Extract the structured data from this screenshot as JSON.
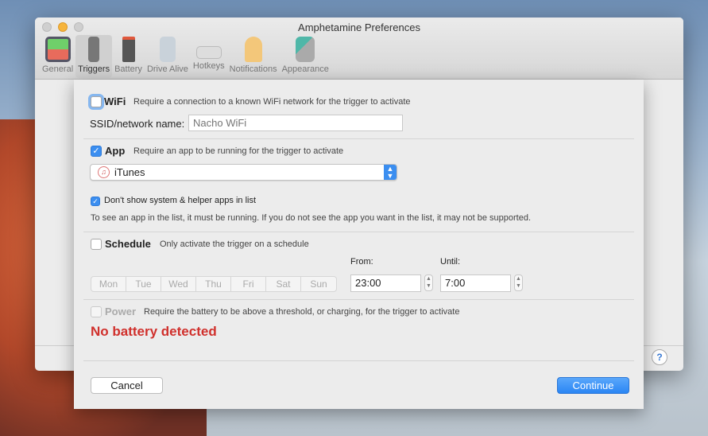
{
  "window": {
    "title": "Amphetamine Preferences"
  },
  "toolbar": [
    {
      "label": "General",
      "icon": "toggles-icon"
    },
    {
      "label": "Triggers",
      "icon": "traffic-light-icon"
    },
    {
      "label": "Battery",
      "icon": "battery-icon"
    },
    {
      "label": "Drive Alive",
      "icon": "drive-icon"
    },
    {
      "label": "Hotkeys",
      "icon": "keyboard-icon"
    },
    {
      "label": "Notifications",
      "icon": "bell-icon"
    },
    {
      "label": "Appearance",
      "icon": "paint-icon"
    }
  ],
  "help": "?",
  "wifi": {
    "label": "WiFi",
    "desc": "Require a connection to a known WiFi network for the trigger to activate",
    "checked": false,
    "ssid_label": "SSID/network name:",
    "ssid_placeholder": "Nacho WiFi"
  },
  "app": {
    "label": "App",
    "desc": "Require an app to be running for the trigger to activate",
    "checked": true,
    "selected": "iTunes",
    "hide_system_label": "Don't show system & helper apps in list",
    "hide_system_checked": true,
    "note": "To see an app in the list, it must be running. If you do not see the app you want in the list, it may not be supported."
  },
  "schedule": {
    "label": "Schedule",
    "desc": "Only activate the trigger on a schedule",
    "checked": false,
    "days": [
      "Mon",
      "Tue",
      "Wed",
      "Thu",
      "Fri",
      "Sat",
      "Sun"
    ],
    "from_label": "From:",
    "from": "23:00",
    "until_label": "Until:",
    "until": "7:00"
  },
  "power": {
    "label": "Power",
    "desc": "Require the battery to be above a threshold, or charging, for the trigger to activate",
    "checked": false,
    "error": "No battery detected"
  },
  "buttons": {
    "cancel": "Cancel",
    "continue": "Continue"
  },
  "colors": {
    "accent": "#3b8ef0",
    "error": "#d0302c"
  }
}
